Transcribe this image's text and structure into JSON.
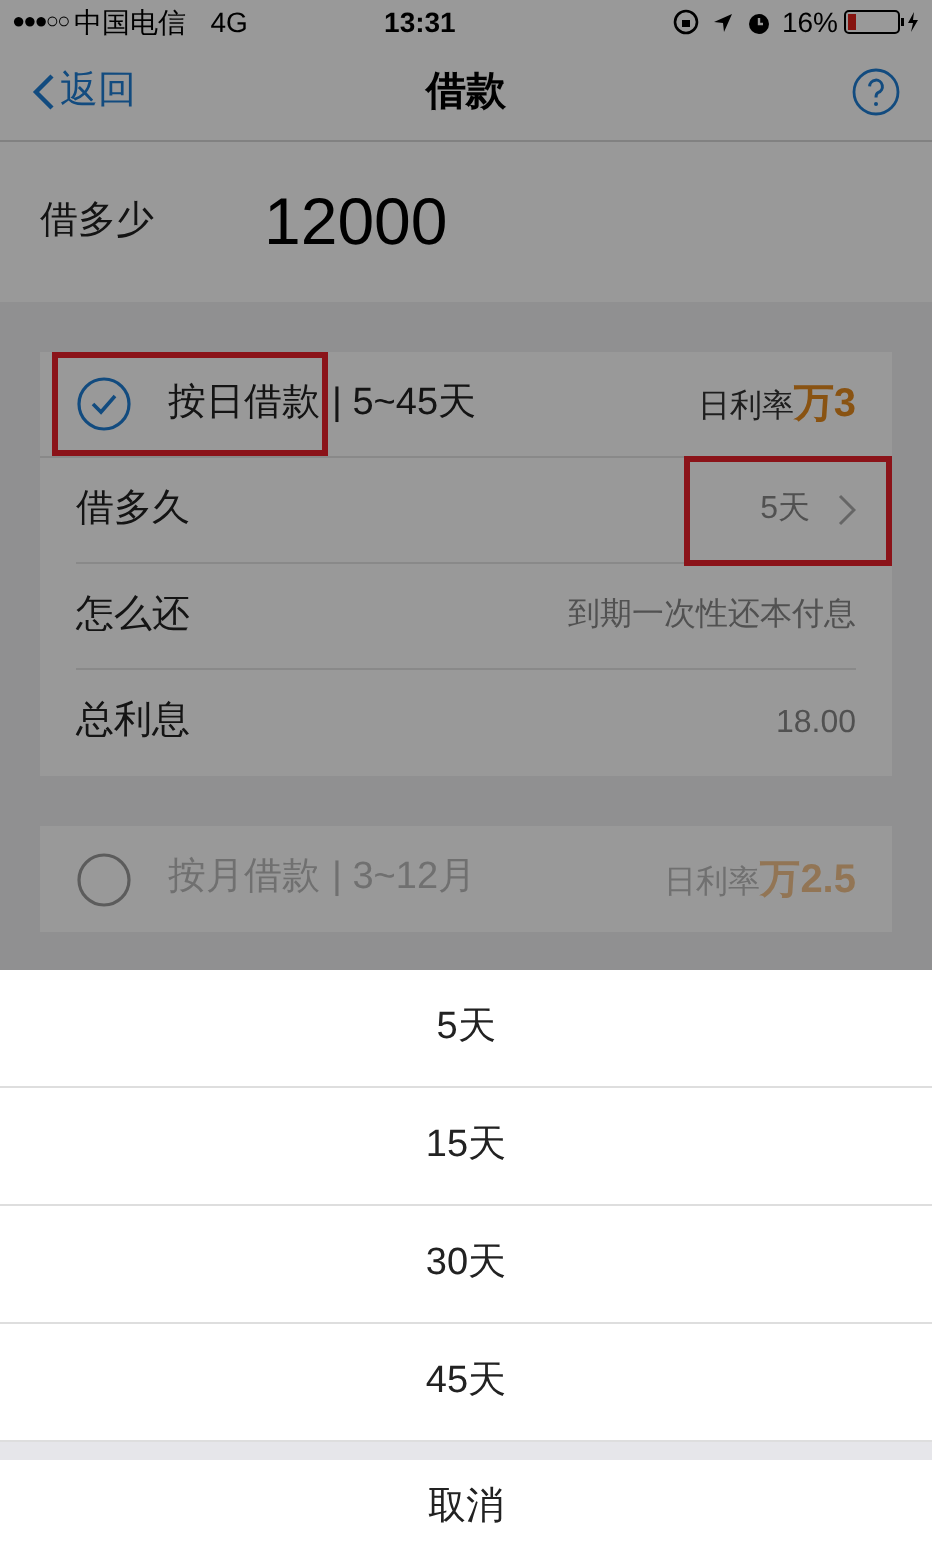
{
  "status_bar": {
    "signal": "●●●○○",
    "carrier": "中国电信",
    "network": "4G",
    "time": "13:31",
    "battery": "16%"
  },
  "nav": {
    "back": "返回",
    "title": "借款"
  },
  "amount": {
    "label": "借多少",
    "value": "12000"
  },
  "plans": [
    {
      "name": "按日借款",
      "range": "| 5~45天",
      "rate_label": "日利率",
      "rate_value": "万3",
      "selected": true,
      "highlighted": true,
      "rows": [
        {
          "label": "借多久",
          "value": "5天",
          "has_arrow": true,
          "highlighted": true
        },
        {
          "label": "怎么还",
          "value": "到期一次性还本付息",
          "has_arrow": false,
          "highlighted": false
        },
        {
          "label": "总利息",
          "value": "18.00",
          "has_arrow": false,
          "highlighted": false
        }
      ]
    },
    {
      "name": "按月借款",
      "range": "| 3~12月",
      "rate_label": "日利率",
      "rate_value": "万2.5",
      "selected": false,
      "highlighted": false
    }
  ],
  "action_sheet": {
    "options": [
      "5天",
      "15天",
      "30天",
      "45天"
    ],
    "cancel": "取消"
  }
}
